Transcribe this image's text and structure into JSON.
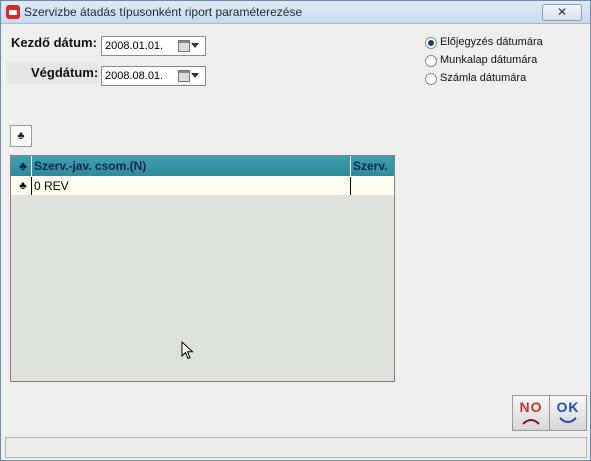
{
  "window": {
    "title": "Szervizbe átadás típusonként riport paraméterezése",
    "close_label": "✕"
  },
  "form": {
    "start_label": "Kezdő dátum:",
    "start_value": "2008.01.01.",
    "end_label": "Végdátum:",
    "end_value": "2008.08.01."
  },
  "radio_options": [
    {
      "label": "Előjegyzés dátumára",
      "selected": true
    },
    {
      "label": "Munkalap dátumára",
      "selected": false
    },
    {
      "label": "Számla dátumára",
      "selected": false
    }
  ],
  "toolbar": {
    "club_icon": "♣"
  },
  "grid": {
    "columns": [
      "Szerv.-jav. csom.(N)",
      "Szerv."
    ],
    "header_icon": "♣",
    "rows": [
      {
        "icon": "♣",
        "cells": [
          "0 REV",
          ""
        ]
      }
    ]
  },
  "buttons": {
    "no_label": "NO",
    "ok_label": "OK",
    "no_color": "#c0392b",
    "ok_color": "#1e4fb0"
  }
}
